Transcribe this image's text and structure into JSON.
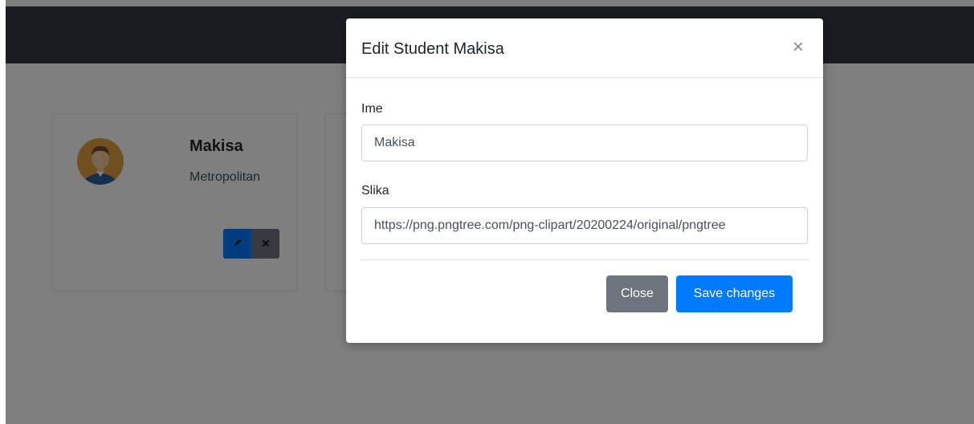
{
  "navbar": {},
  "student_card": {
    "name": "Makisa",
    "subtitle": "Metropolitan",
    "avatar_icon": "avatar-icon",
    "edit_icon": "pencil-icon",
    "delete_icon": "close-icon"
  },
  "modal": {
    "title": "Edit Student Makisa",
    "close_symbol": "×",
    "fields": {
      "ime_label": "Ime",
      "ime_value": "Makisa",
      "slika_label": "Slika",
      "slika_value": "https://png.pngtree.com/png-clipart/20200224/original/pngtree"
    },
    "buttons": {
      "close_label": "Close",
      "save_label": "Save changes"
    }
  },
  "colors": {
    "navbar": "#343a40",
    "primary": "#007bff",
    "secondary": "#6c757d",
    "overlay": "rgba(0,0,0,0.5)"
  }
}
